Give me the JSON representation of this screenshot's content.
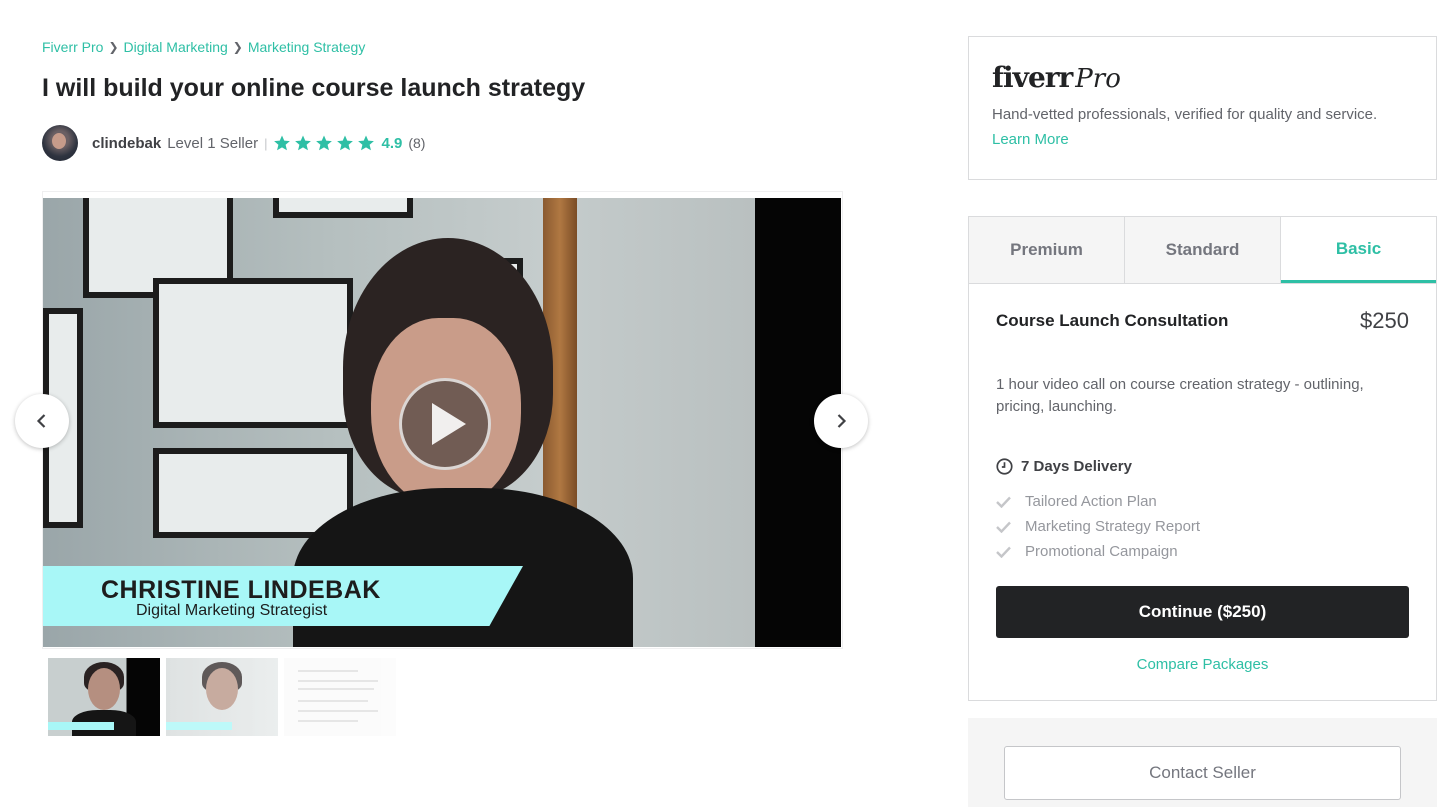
{
  "breadcrumb": [
    "Fiverr Pro",
    "Digital Marketing",
    "Marketing Strategy"
  ],
  "gig": {
    "title": "I will build your online course launch strategy"
  },
  "seller": {
    "username": "clindebak",
    "level": "Level 1 Seller",
    "rating": "4.9",
    "review_count": "(8)",
    "stars": 5
  },
  "video": {
    "lower_third_name": "CHRISTINE LINDEBAK",
    "lower_third_role": "Digital Marketing Strategist"
  },
  "thumbnails_count": 3,
  "pro": {
    "logo_word": "fiverr",
    "logo_suffix": "Pro",
    "description": "Hand-vetted professionals, verified for quality and service.",
    "link": "Learn More"
  },
  "packages": {
    "tabs": [
      "Premium",
      "Standard",
      "Basic"
    ],
    "active_tab": "Basic",
    "name": "Course Launch Consultation",
    "price": "$250",
    "description": "1 hour video call on course creation strategy - outlining, pricing, launching.",
    "delivery": "7 Days Delivery",
    "features": [
      "Tailored Action Plan",
      "Marketing Strategy Report",
      "Promotional Campaign"
    ],
    "continue_label": "Continue ($250)",
    "compare_label": "Compare Packages"
  },
  "contact_label": "Contact Seller",
  "colors": {
    "accent": "#2ebfa5",
    "dark": "#222325"
  }
}
